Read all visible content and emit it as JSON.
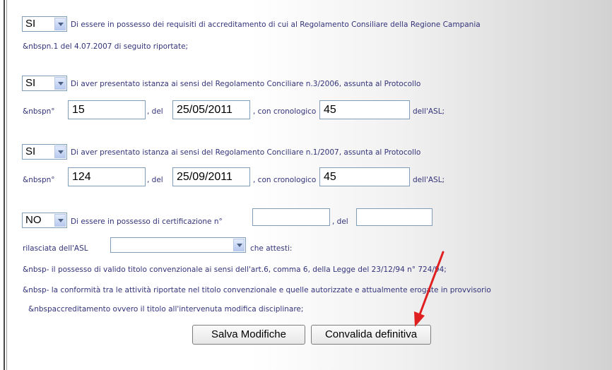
{
  "form": {
    "req1": {
      "select_value": "SI",
      "line1": "Di essere in possesso dei requisiti di accreditamento di cui al Regolamento Consiliare della Regione Campania",
      "line2": "&nbspn.1 del 4.07.2007 di seguito riportate;"
    },
    "req2": {
      "select_value": "SI",
      "line1": "Di aver presentato istanza ai sensi del Regolamento Conciliare n.3/2006, assunta al Protocollo",
      "num_label": "&nbspn°",
      "num_value": "15",
      "del_label": ", del",
      "date_value": "25/05/2011",
      "crono_label": ", con cronologico",
      "crono_value": "45",
      "asl_label": "dell'ASL;"
    },
    "req3": {
      "select_value": "SI",
      "line1": "Di aver presentato istanza ai sensi del Regolamento Conciliare n.1/2007, assunta al Protocollo",
      "num_label": "&nbspn°",
      "num_value": "124",
      "del_label": ", del",
      "date_value": "25/09/2011",
      "crono_label": ", con cronologico",
      "crono_value": "45",
      "asl_label": "dell'ASL;"
    },
    "req4": {
      "select_value": "NO",
      "line1": "Di essere in possesso di certificazione n°",
      "cert_value": "",
      "del_label": ", del",
      "date_value": "",
      "rilasciata_label": "rilasciata dell'ASL",
      "asl_select_value": "",
      "attesti_label": "che attesti:",
      "bullet1": "&nbsp- il possesso di valido titolo convenzionale ai sensi dell'art.6, comma 6, della Legge del 23/12/94 n° 724/94;",
      "bullet2": "&nbsp- la conformità tra le attività riportate nel titolo convenzionale e quelle autorizzate e attualmente erogate in provvisorio",
      "bullet3": "&nbspaccreditamento ovvero il titolo all'intervenuta modifica disciplinare;"
    }
  },
  "buttons": {
    "save_label": "Salva Modifiche",
    "validate_label": "Convalida definitiva"
  },
  "colors": {
    "text": "#33337a",
    "annotation_arrow": "#e02020"
  }
}
